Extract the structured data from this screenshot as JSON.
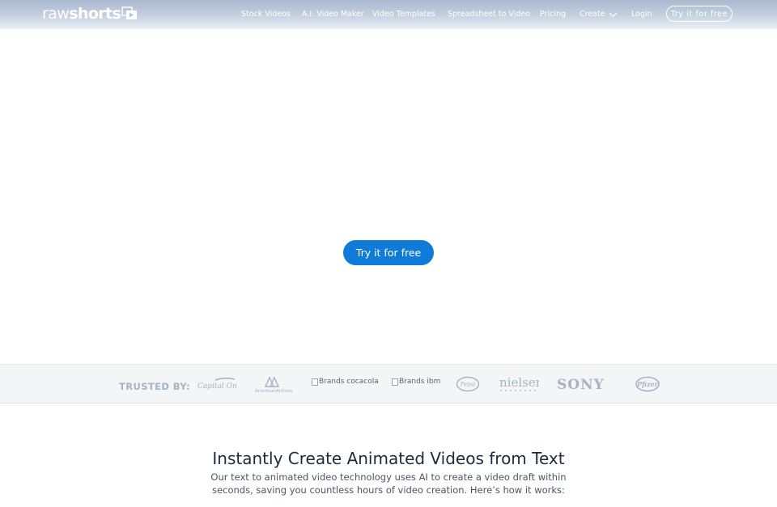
{
  "header": {
    "logo": {
      "part1": "raw",
      "part2": "shorts"
    },
    "nav": [
      {
        "label": "Stock Videos"
      },
      {
        "label": "A.I. Video Maker"
      },
      {
        "label": "Video Templates"
      },
      {
        "label": "Spreadsheet to Video"
      },
      {
        "label": "Pricing"
      },
      {
        "label": "Create"
      },
      {
        "label": "Login"
      }
    ],
    "cta_label": "Try it for free"
  },
  "hero": {
    "cta_label": "Try it for free"
  },
  "trusted": {
    "label": "TRUSTED BY:",
    "logos": [
      {
        "name": "capital-one-logo",
        "text": "Capital One"
      },
      {
        "name": "american-airlines-logo",
        "text": "AmericanAirlines"
      },
      {
        "name": "coca-cola-logo",
        "alt": "Brands cocacola"
      },
      {
        "name": "ibm-logo",
        "alt": "Brands ibm"
      },
      {
        "name": "pepsi-logo",
        "text": "Pepsi"
      },
      {
        "name": "nielsen-logo",
        "text": "nielsen"
      },
      {
        "name": "sony-logo",
        "text": "SONY"
      },
      {
        "name": "pfizer-logo",
        "text": "Pfizer"
      }
    ]
  },
  "intro": {
    "title": "Instantly Create Animated Videos from Text",
    "description": "Our text to animated video technology uses AI to create a video draft within seconds, saving you countless hours of video creation. Here’s how it works:"
  },
  "colors": {
    "accent": "#0f7bd8",
    "header_gradient_top": "#a9b8cf",
    "trusted_bg": "#f4f5f6",
    "logo_gray": "#a7b3c4"
  }
}
